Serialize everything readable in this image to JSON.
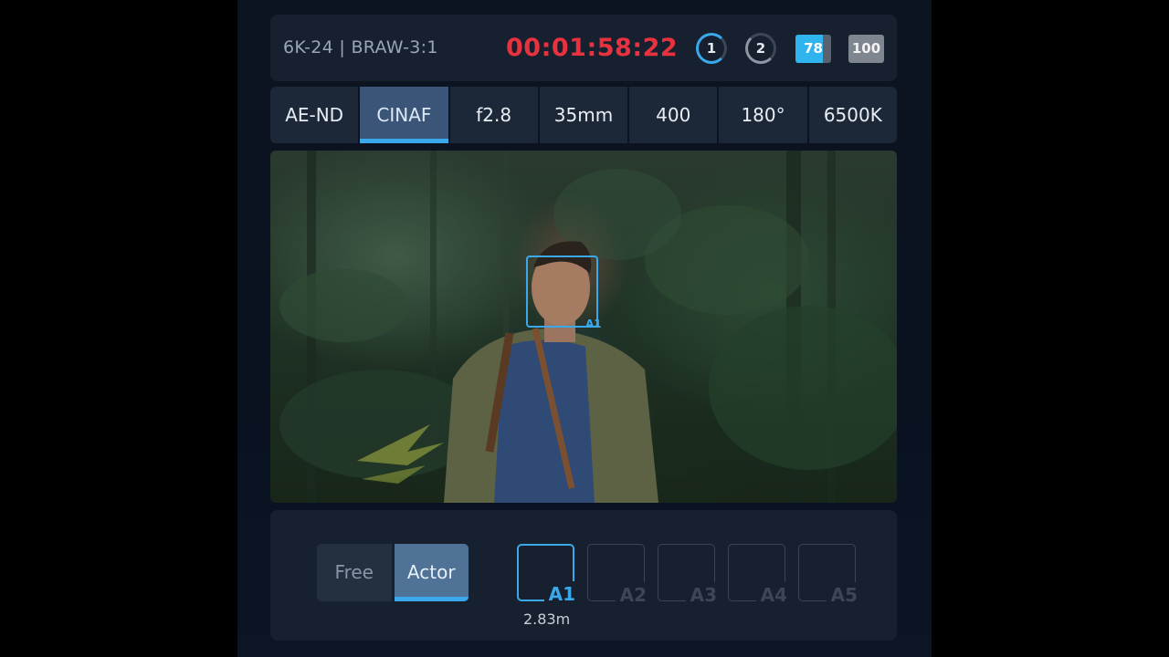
{
  "status": {
    "format": "6K-24 | BRAW-3:1",
    "timecode": "00:01:58:22",
    "card_slot_1": "1",
    "card_slot_2": "2",
    "level_1": 78,
    "level_1_label": "78",
    "level_2_label": "100"
  },
  "settings": [
    {
      "label": "AE-ND"
    },
    {
      "label": "CINAF",
      "active": true
    },
    {
      "label": "f2.8"
    },
    {
      "label": "35mm"
    },
    {
      "label": "400"
    },
    {
      "label": "180°"
    },
    {
      "label": "6500K"
    }
  ],
  "viewfinder": {
    "tracked_subject": "A1"
  },
  "tracking": {
    "modes": [
      {
        "label": "Free"
      },
      {
        "label": "Actor",
        "active": true
      }
    ],
    "actors": [
      {
        "label": "A1",
        "active": true
      },
      {
        "label": "A2"
      },
      {
        "label": "A3"
      },
      {
        "label": "A4"
      },
      {
        "label": "A5"
      }
    ],
    "distance": "2.83m"
  },
  "colors": {
    "accent": "#3aa8ea",
    "recording_timecode": "#e8323f",
    "panel": "#16202f"
  }
}
